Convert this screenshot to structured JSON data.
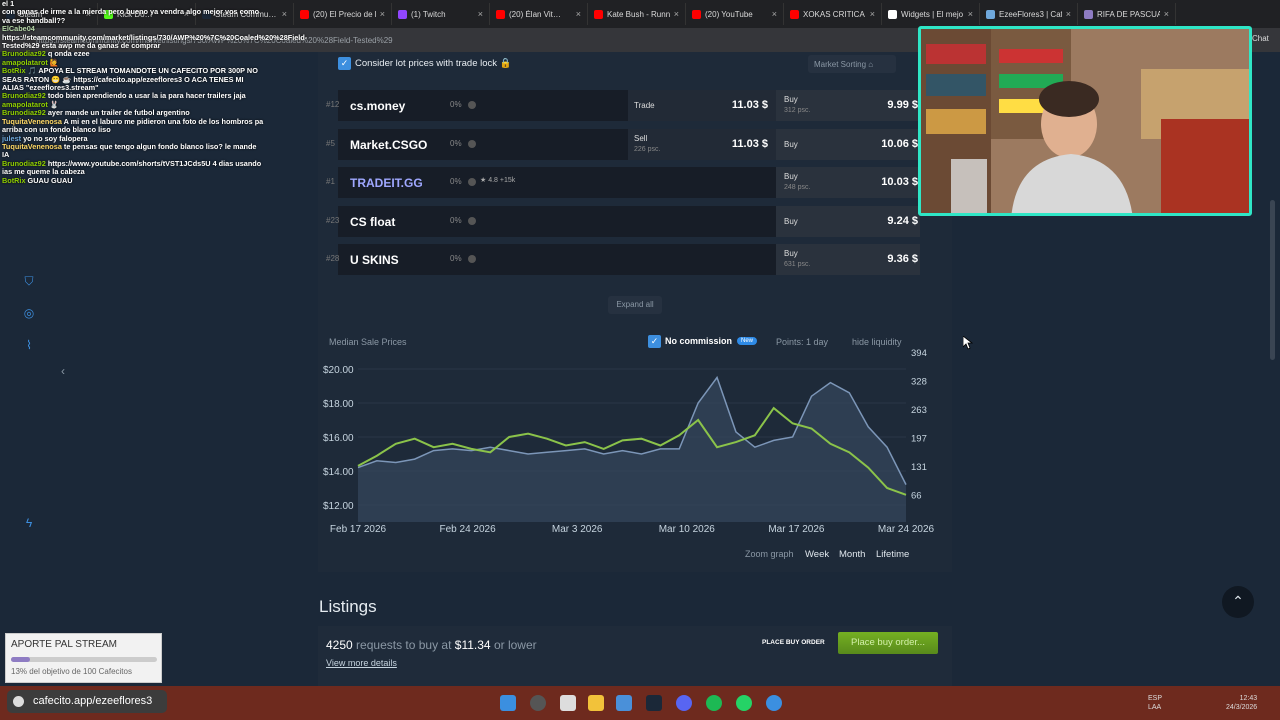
{
  "browser": {
    "tabs": [
      {
        "label": "Steam",
        "color": "#1b2838"
      },
      {
        "label": "Kick Do…",
        "color": "#53fc18"
      },
      {
        "label": "Steam Commu…",
        "color": "#1b2838"
      },
      {
        "label": "(20) El Precio de l",
        "color": "#ff0000"
      },
      {
        "label": "(1) Twitch",
        "color": "#9146ff"
      },
      {
        "label": "(20) Élan Vit…",
        "color": "#ff0000"
      },
      {
        "label": "Kate Bush - Runn",
        "color": "#ff0000"
      },
      {
        "label": "(20) YouTube",
        "color": "#ff0000"
      },
      {
        "label": "XOKAS CRITICA a",
        "color": "#ff0000"
      },
      {
        "label": "Widgets | El mejo",
        "color": "#ffffff"
      },
      {
        "label": "EzeeFlores3 | Caf",
        "color": "#6fa8dc"
      },
      {
        "label": "RIFA DE PASCUA",
        "color": "#8e7cc3"
      }
    ],
    "url": "https://steamcommunity.com/market/listings/730/AWP%20%7C%20Coaled%20%28Field-Tested%29",
    "chat_btn": "Chat"
  },
  "chat": [
    {
      "user": "",
      "color": "#ffffff",
      "msg": "el 1"
    },
    {
      "user": "",
      "color": "#ffffff",
      "msg": "con ganas de irme a la mierda pero bueno ya vendra algo mejor vos como va ese handball??"
    },
    {
      "user": "ElCabe04",
      "color": "#b6d7a8",
      "msg": "https://steamcommunity.com/market/listings/730/AWP%20%7C%20Coaled%20%28Field-Tested%29 esta awp me da ganas de comprar"
    },
    {
      "user": "Brunodiaz92",
      "color": "#8fce00",
      "msg": "q onda ezee"
    },
    {
      "user": "amapolatarot",
      "color": "#8fce00",
      "msg": "🙋"
    },
    {
      "user": "BotRix",
      "color": "#8fce00",
      "msg": "🎵 APOYA EL STREAM TOMANDOTE UN CAFECITO POR 300P NO SEAS RATON 😁 ☕ https://cafecito.app/ezeeflores3 O ACA TENES MI ALIAS \"ezeeflores3.stream\""
    },
    {
      "user": "Brunodiaz92",
      "color": "#8fce00",
      "msg": "todo bien aprendiendo a usar la ia para hacer trailers jaja"
    },
    {
      "user": "amapolatarot",
      "color": "#8fce00",
      "msg": "🐰"
    },
    {
      "user": "Brunodiaz92",
      "color": "#8fce00",
      "msg": "ayer mande un trailer de futbol argentino"
    },
    {
      "user": "TuquitaVenenosa",
      "color": "#ffd966",
      "msg": "A mi en el laburo me pidieron una foto de los hombros pa arriba con un fondo blanco liso"
    },
    {
      "user": "julest",
      "color": "#6fa8dc",
      "msg": "yo no soy falopera"
    },
    {
      "user": "TuquitaVenenosa",
      "color": "#ffd966",
      "msg": "te pensas que tengo algun fondo blanco liso? le mande IA"
    },
    {
      "user": "Brunodiaz92",
      "color": "#8fce00",
      "msg": "https://www.youtube.com/shorts/tVST1JCds5U 4 dias usando ias me queme la cabeza"
    },
    {
      "user": "BotRix",
      "color": "#8fce00",
      "msg": "GUAU GUAU"
    }
  ],
  "market": {
    "trade_lock_label": "Consider lot prices with trade lock 🔒",
    "sorting_label": "Market Sorting",
    "rows": [
      {
        "rank": "#12",
        "name": "cs.money",
        "pct": "0%",
        "mode": "Trade",
        "sell_sub": "",
        "sell": "11.03 $",
        "buy_label": "Buy",
        "buy_sub": "312 psc.",
        "buy": "9.99 $",
        "logo_color": "#ffffff",
        "badge": ""
      },
      {
        "rank": "#5",
        "name": "Market.CSGO",
        "pct": "0%",
        "mode": "Sell",
        "sell_sub": "226 psc.",
        "sell": "11.03 $",
        "buy_label": "Buy",
        "buy_sub": "",
        "buy": "10.06 $",
        "logo_color": "#ffffff",
        "badge": ""
      },
      {
        "rank": "#1",
        "name": "TRADEIT.GG",
        "pct": "0%",
        "mode": "",
        "sell_sub": "",
        "sell": "",
        "buy_label": "Buy",
        "buy_sub": "248 psc.",
        "buy": "10.03 $",
        "logo_color": "#9fa8ff",
        "badge": "★ 4.8 +15k"
      },
      {
        "rank": "#23",
        "name": "CS float",
        "pct": "0%",
        "mode": "",
        "sell_sub": "",
        "sell": "",
        "buy_label": "Buy",
        "buy_sub": "",
        "buy": "9.24 $",
        "logo_color": "#ffffff",
        "badge": ""
      },
      {
        "rank": "#28",
        "name": "U SKINS",
        "pct": "0%",
        "mode": "",
        "sell_sub": "",
        "sell": "",
        "buy_label": "Buy",
        "buy_sub": "631 psc.",
        "buy": "9.36 $",
        "logo_color": "#ffffff",
        "badge": ""
      }
    ],
    "expand_all": "Expand all"
  },
  "graph": {
    "title": "Median Sale Prices",
    "no_commission": "No commission",
    "new_badge": "New",
    "points": "Points: 1 day",
    "hide_liquidity": "hide liquidity",
    "zoom_label": "Zoom graph",
    "zoom": [
      "Week",
      "Month",
      "Lifetime"
    ]
  },
  "chart_data": {
    "type": "line",
    "title": "Median Sale Prices",
    "x": [
      "Feb 17 2026",
      "Feb 24 2026",
      "Mar 3 2026",
      "Mar 10 2026",
      "Mar 17 2026",
      "Mar 24 2026"
    ],
    "y_left_ticks": [
      "$20.00",
      "$18.00",
      "$16.00",
      "$14.00",
      "$12.00"
    ],
    "y_right_ticks": [
      "394",
      "328",
      "263",
      "197",
      "131",
      "66"
    ],
    "series": [
      {
        "values": [
          14.3,
          14.9,
          15.6,
          15.9,
          15.4,
          15.6,
          15.3,
          15.1,
          16.0,
          16.2,
          15.9,
          15.5,
          15.7,
          15.3,
          15.8,
          15.9,
          15.5,
          16.1,
          17.0,
          15.4,
          15.7,
          16.1,
          17.7,
          16.8,
          16.5,
          15.6,
          15.1,
          14.2,
          13.0,
          12.6
        ],
        "color": "#8bc34a"
      },
      {
        "values": [
          14.2,
          14.6,
          14.5,
          14.7,
          15.2,
          15.3,
          15.2,
          15.4,
          15.2,
          15.0,
          15.1,
          15.2,
          15.3,
          15.0,
          15.2,
          15.0,
          15.3,
          15.3,
          18.0,
          19.5,
          16.3,
          15.4,
          15.8,
          16.0,
          18.4,
          19.2,
          18.6,
          16.6,
          15.4,
          13.2
        ],
        "color": "#7c96b8"
      }
    ],
    "ylim": [
      11.0,
      21.0
    ]
  },
  "listings": {
    "title": "Listings",
    "count": "4250",
    "mid": "requests to buy at",
    "price": "$11.34",
    "tail": "or lower",
    "view_more": "View more details",
    "place_buy_order": "PLACE BUY ORDER",
    "place_buy_order2": "Place buy order..."
  },
  "overlay": {
    "aporte_title": "APORTE PAL STREAM",
    "aporte_sub": "13% del objetivo de 100 Cafecitos",
    "aporte_progress": 0.13,
    "cafecito": "cafecito.app/ezeeflores3"
  },
  "taskbar": {
    "lang": "ESP",
    "lang2": "LAA",
    "time": "12:43",
    "date": "24/3/2026"
  }
}
